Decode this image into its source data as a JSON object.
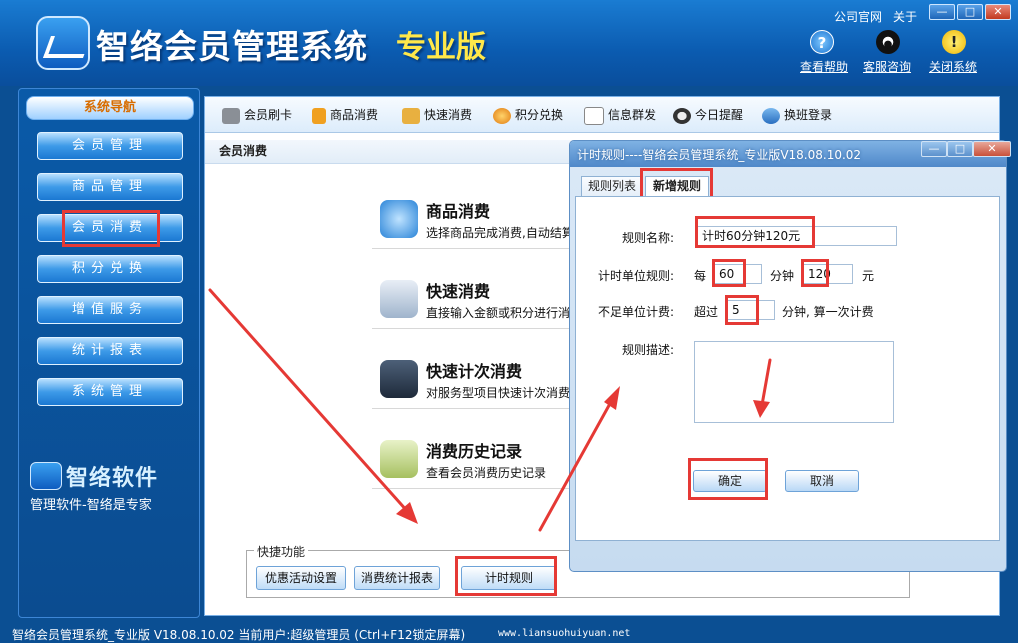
{
  "header": {
    "title": "智络会员管理系统",
    "edition": "专业版",
    "links": [
      "公司官网",
      "关于"
    ],
    "window_controls": [
      "—",
      "□",
      "✕"
    ],
    "actions": [
      {
        "label": "查看帮助",
        "icon": "help-icon",
        "glyph": "?"
      },
      {
        "label": "客服咨询",
        "icon": "qq-penguin-icon",
        "glyph": "●"
      },
      {
        "label": "关闭系统",
        "icon": "warning-icon",
        "glyph": "!"
      }
    ]
  },
  "sidebar": {
    "header": "系统导航",
    "items": [
      "会员管理",
      "商品管理",
      "会员消费",
      "积分兑换",
      "增值服务",
      "统计报表",
      "系统管理"
    ],
    "selected": "会员消费",
    "brand": "智络软件",
    "slogan": "管理软件-智络是专家"
  },
  "toolbar": {
    "items": [
      {
        "label": "会员刷卡",
        "icon": "card-reader-icon"
      },
      {
        "label": "商品消费",
        "icon": "money-bag-icon"
      },
      {
        "label": "快速消费",
        "icon": "cash-icon"
      },
      {
        "label": "积分兑换",
        "icon": "exchange-icon"
      },
      {
        "label": "信息群发",
        "icon": "mail-icon"
      },
      {
        "label": "今日提醒",
        "icon": "clock-icon"
      },
      {
        "label": "换班登录",
        "icon": "shift-login-icon"
      }
    ]
  },
  "main": {
    "section_title": "会员消费",
    "features": [
      {
        "title": "商品消费",
        "desc": "选择商品完成消费,自动结算",
        "icon": "product-consume-icon"
      },
      {
        "title": "快速消费",
        "desc": "直接输入金额或积分进行消费",
        "icon": "quick-consume-icon"
      },
      {
        "title": "快速计次消费",
        "desc": "对服务型项目快速计次消费",
        "icon": "count-consume-icon"
      },
      {
        "title": "消费历史记录",
        "desc": "查看会员消费历史记录",
        "icon": "history-icon"
      }
    ],
    "quick": {
      "legend": "快捷功能",
      "buttons": [
        "优惠活动设置",
        "消费统计报表",
        "计时规则"
      ]
    }
  },
  "statusbar": {
    "text": "智络会员管理系统_专业版 V18.08.10.02 当前用户:超级管理员 (Ctrl+F12锁定屏幕)",
    "url": "www.liansuohuiyuan.net"
  },
  "dialog": {
    "title": "计时规则----智络会员管理系统_专业版V18.08.10.02",
    "controls": [
      "—",
      "□",
      "✕"
    ],
    "tabs": [
      "规则列表",
      "新增规则"
    ],
    "active_tab": "新增规则",
    "form": {
      "name_label": "规则名称:",
      "name_value": "计时60分钟120元",
      "unit_label": "计时单位规则:",
      "unit_prefix": "每",
      "unit_minutes": "60",
      "unit_mid": "分钟",
      "unit_price": "120",
      "unit_suffix": "元",
      "short_label": "不足单位计费:",
      "short_prefix": "超过",
      "short_minutes": "5",
      "short_suffix": "分钟, 算一次计费",
      "desc_label": "规则描述:",
      "desc_value": ""
    },
    "buttons": {
      "ok": "确定",
      "cancel": "取消"
    }
  },
  "colors": {
    "highlight": "#e53935",
    "brand_blue": "#0b5bb0",
    "edition_yellow": "#ffe84a"
  }
}
